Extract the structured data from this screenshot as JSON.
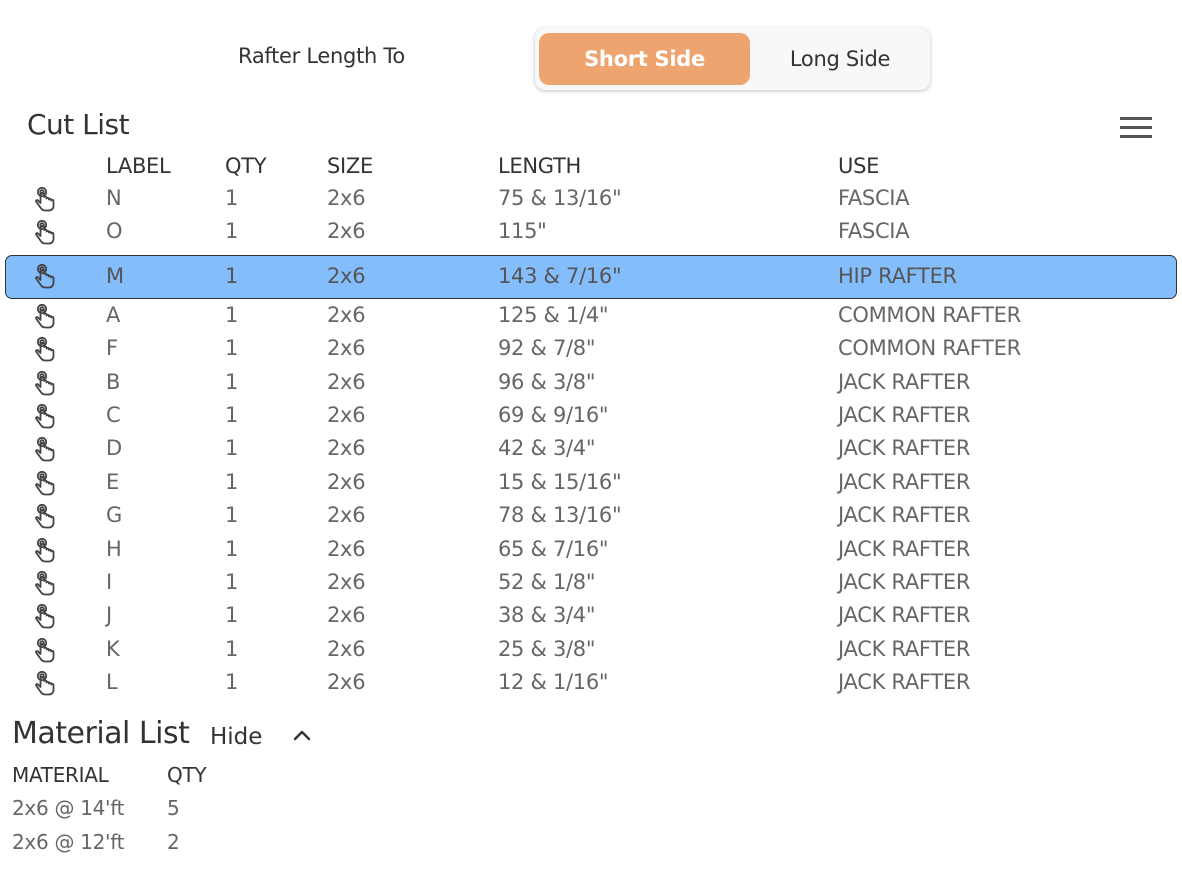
{
  "rafter_length": {
    "label": "Rafter Length To",
    "options": [
      {
        "label": "Short Side",
        "selected": true
      },
      {
        "label": "Long Side",
        "selected": false
      }
    ],
    "selected_color": "#eea46f"
  },
  "cut_list": {
    "title": "Cut List",
    "menu_icon": "hamburger-menu-icon",
    "row_icon": "touch-hand-icon",
    "selected_color": "#84bdfb",
    "columns": [
      "LABEL",
      "QTY",
      "SIZE",
      "LENGTH",
      "USE"
    ],
    "rows": [
      {
        "label": "N",
        "qty": "1",
        "size": "2x6",
        "length": "75 & 13/16\"",
        "use": "FASCIA",
        "selected": false
      },
      {
        "label": "O",
        "qty": "1",
        "size": "2x6",
        "length": "115\"",
        "use": "FASCIA",
        "selected": false
      },
      {
        "label": "M",
        "qty": "1",
        "size": "2x6",
        "length": "143 & 7/16\"",
        "use": "HIP RAFTER",
        "selected": true
      },
      {
        "label": "A",
        "qty": "1",
        "size": "2x6",
        "length": "125 & 1/4\"",
        "use": "COMMON RAFTER",
        "selected": false
      },
      {
        "label": "F",
        "qty": "1",
        "size": "2x6",
        "length": "92 & 7/8\"",
        "use": "COMMON RAFTER",
        "selected": false
      },
      {
        "label": "B",
        "qty": "1",
        "size": "2x6",
        "length": "96 & 3/8\"",
        "use": "JACK RAFTER",
        "selected": false
      },
      {
        "label": "C",
        "qty": "1",
        "size": "2x6",
        "length": "69 & 9/16\"",
        "use": "JACK RAFTER",
        "selected": false
      },
      {
        "label": "D",
        "qty": "1",
        "size": "2x6",
        "length": "42 & 3/4\"",
        "use": "JACK RAFTER",
        "selected": false
      },
      {
        "label": "E",
        "qty": "1",
        "size": "2x6",
        "length": "15 & 15/16\"",
        "use": "JACK RAFTER",
        "selected": false
      },
      {
        "label": "G",
        "qty": "1",
        "size": "2x6",
        "length": "78 & 13/16\"",
        "use": "JACK RAFTER",
        "selected": false
      },
      {
        "label": "H",
        "qty": "1",
        "size": "2x6",
        "length": "65 & 7/16\"",
        "use": "JACK RAFTER",
        "selected": false
      },
      {
        "label": "I",
        "qty": "1",
        "size": "2x6",
        "length": "52 & 1/8\"",
        "use": "JACK RAFTER",
        "selected": false
      },
      {
        "label": "J",
        "qty": "1",
        "size": "2x6",
        "length": "38 & 3/4\"",
        "use": "JACK RAFTER",
        "selected": false
      },
      {
        "label": "K",
        "qty": "1",
        "size": "2x6",
        "length": "25 & 3/8\"",
        "use": "JACK RAFTER",
        "selected": false
      },
      {
        "label": "L",
        "qty": "1",
        "size": "2x6",
        "length": "12 & 1/16\"",
        "use": "JACK RAFTER",
        "selected": false
      }
    ]
  },
  "material_list": {
    "title": "Material List",
    "toggle_label": "Hide",
    "toggle_icon": "chevron-up-icon",
    "columns": [
      "MATERIAL",
      "QTY"
    ],
    "rows": [
      {
        "material": "2x6 @ 14'ft",
        "qty": "5"
      },
      {
        "material": "2x6 @ 12'ft",
        "qty": "2"
      }
    ]
  }
}
